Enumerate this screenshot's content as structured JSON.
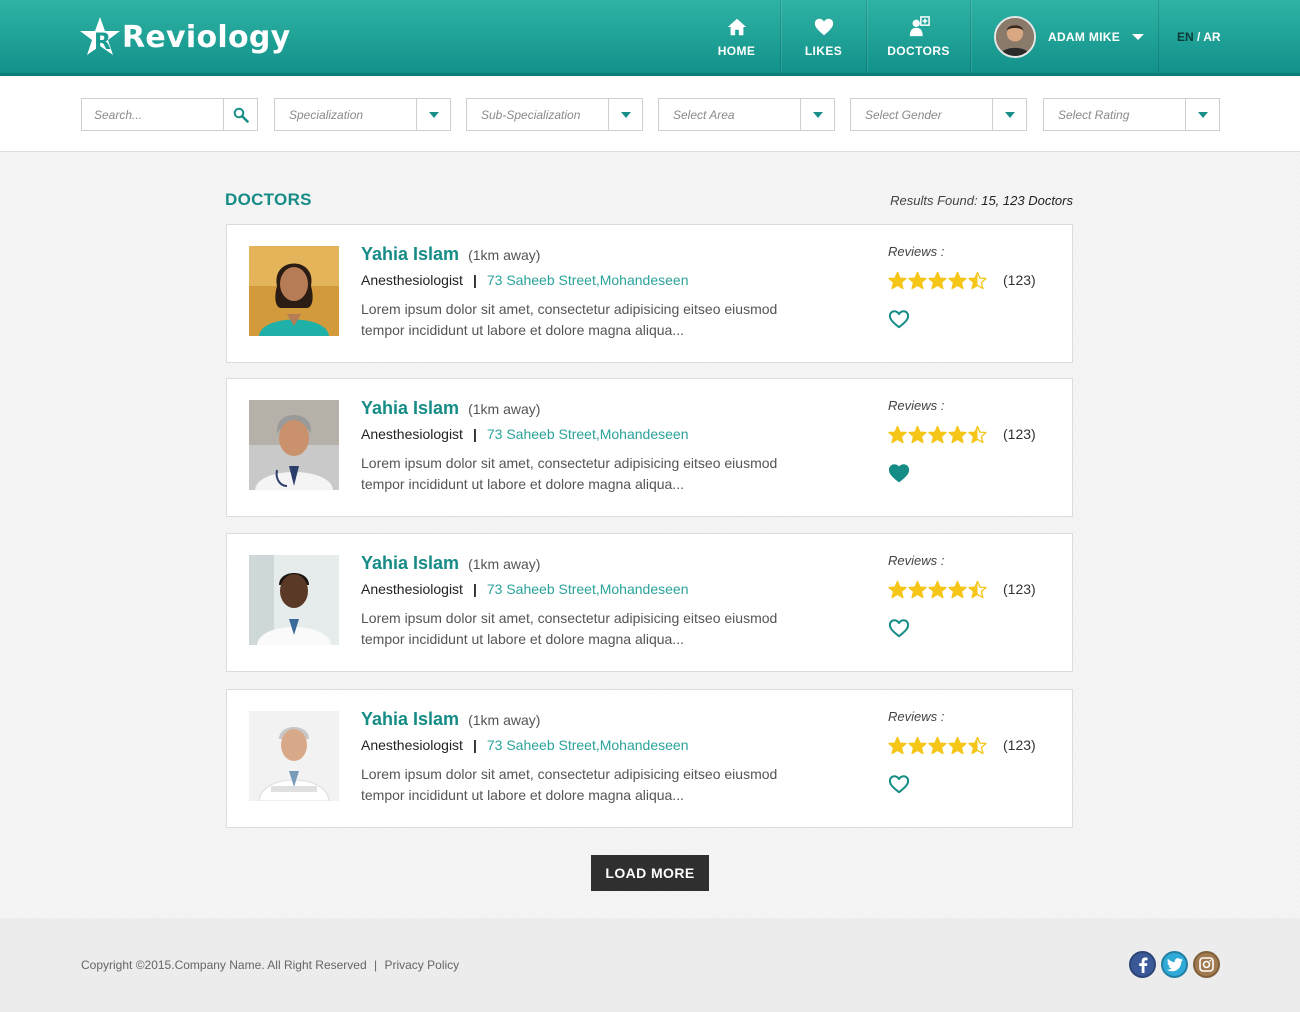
{
  "brand": {
    "name": "Reviology",
    "logo_letter": "R"
  },
  "nav": {
    "items": [
      {
        "label": "HOME",
        "icon": "home-icon"
      },
      {
        "label": "LIKES",
        "icon": "heart-icon"
      },
      {
        "label": "DOCTORS",
        "icon": "doctor-icon"
      }
    ]
  },
  "user": {
    "name": "ADAM MIKE"
  },
  "language": {
    "en": "EN",
    "separator": "/",
    "ar": "AR"
  },
  "filters": {
    "search_placeholder": "Search...",
    "selects": [
      "Specialization",
      "Sub-Specialization",
      "Select Area",
      "Select Gender",
      "Select Rating"
    ]
  },
  "section": {
    "title": "DOCTORS",
    "results_label": "Results Found:",
    "results_value": "15, 123 Doctors"
  },
  "doctors": [
    {
      "name": "Yahia Islam",
      "distance": "(1km  away)",
      "specialty": "Anesthesiologist",
      "separator": "|",
      "address": "73 Saheeb Street,Mohandeseen",
      "description": "Lorem ipsum dolor sit amet, consectetur adipisicing eitseo eiusmod tempor incididunt ut labore et dolore magna aliqua...",
      "reviews_label": "Reviews :",
      "rating": 4.5,
      "review_count": "(123)",
      "liked": false
    },
    {
      "name": "Yahia Islam",
      "distance": "(1km  away)",
      "specialty": "Anesthesiologist",
      "separator": "|",
      "address": "73 Saheeb Street,Mohandeseen",
      "description": "Lorem ipsum dolor sit amet, consectetur adipisicing eitseo eiusmod tempor incididunt ut labore et dolore magna aliqua...",
      "reviews_label": "Reviews :",
      "rating": 4.5,
      "review_count": "(123)",
      "liked": true
    },
    {
      "name": "Yahia Islam",
      "distance": "(1km  away)",
      "specialty": "Anesthesiologist",
      "separator": "|",
      "address": "73 Saheeb Street,Mohandeseen",
      "description": "Lorem ipsum dolor sit amet, consectetur adipisicing eitseo eiusmod tempor incididunt ut labore et dolore magna aliqua...",
      "reviews_label": "Reviews :",
      "rating": 4.5,
      "review_count": "(123)",
      "liked": false
    },
    {
      "name": "Yahia Islam",
      "distance": "(1km  away)",
      "specialty": "Anesthesiologist",
      "separator": "|",
      "address": "73 Saheeb Street,Mohandeseen",
      "description": "Lorem ipsum dolor sit amet, consectetur adipisicing eitseo eiusmod tempor incididunt ut labore et dolore magna aliqua...",
      "reviews_label": "Reviews :",
      "rating": 4.5,
      "review_count": "(123)",
      "liked": false
    }
  ],
  "load_more": "LOAD MORE",
  "footer": {
    "copyright": "Copyright ©2015.Company Name. All Right Reserved",
    "separator": "|",
    "privacy": "Privacy Policy",
    "socials": [
      "facebook-icon",
      "twitter-icon",
      "instagram-icon"
    ]
  },
  "colors": {
    "header": "#1ea297",
    "accent": "#168c86",
    "link": "#2aa39b",
    "star": "#f5c518",
    "button_dark": "#2f2f2f"
  }
}
